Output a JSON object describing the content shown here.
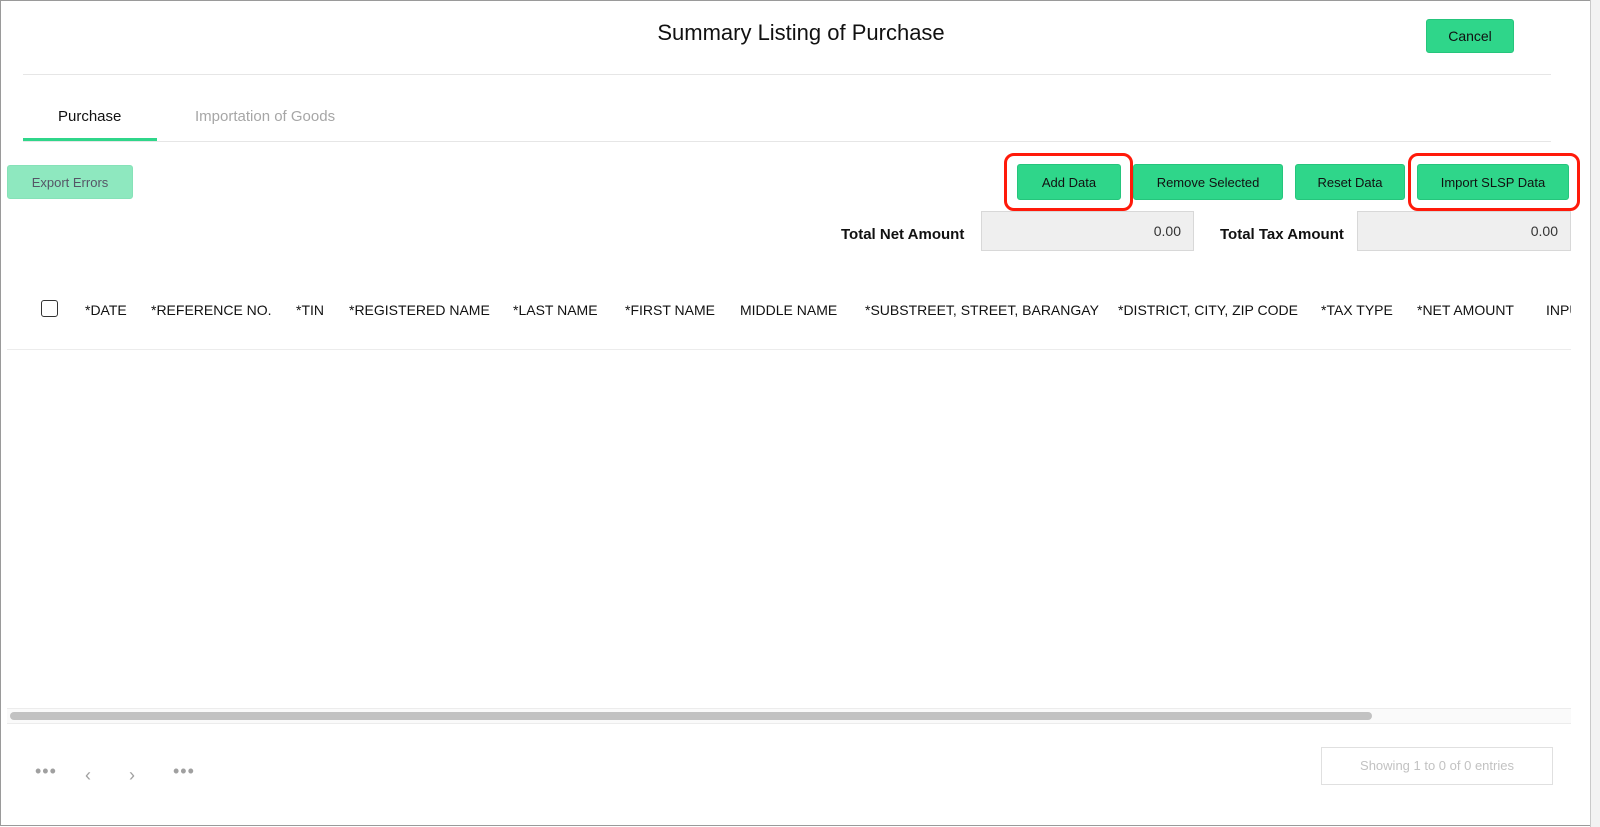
{
  "dialog": {
    "title": "Summary Listing of Purchase",
    "cancel_label": "Cancel"
  },
  "tabs": [
    {
      "label": "Purchase",
      "active": true
    },
    {
      "label": "Importation of Goods",
      "active": false
    }
  ],
  "toolbar": {
    "export_errors_label": "Export Errors",
    "add_data_label": "Add Data",
    "remove_selected_label": "Remove Selected",
    "reset_data_label": "Reset Data",
    "import_slsp_label": "Import SLSP Data"
  },
  "totals": {
    "net_label": "Total Net Amount",
    "net_value": "0.00",
    "tax_label": "Total Tax Amount",
    "tax_value": "0.00"
  },
  "table": {
    "columns": [
      "*DATE",
      "*REFERENCE NO.",
      "*TIN",
      "*REGISTERED NAME",
      "*LAST NAME",
      "*FIRST NAME",
      "MIDDLE NAME",
      "*SUBSTREET, STREET, BARANGAY",
      "*DISTRICT, CITY, ZIP CODE",
      "*TAX TYPE",
      "*NET AMOUNT",
      "INPU"
    ],
    "rows": []
  },
  "pagination": {
    "first_icon": "ellipsis-icon",
    "prev_icon": "chevron-left-icon",
    "next_icon": "chevron-right-icon",
    "last_icon": "ellipsis-icon",
    "entries_text": "Showing 1 to 0 of 0 entries"
  },
  "colors": {
    "accent": "#2fd68a",
    "highlight": "#ff1a0a"
  }
}
